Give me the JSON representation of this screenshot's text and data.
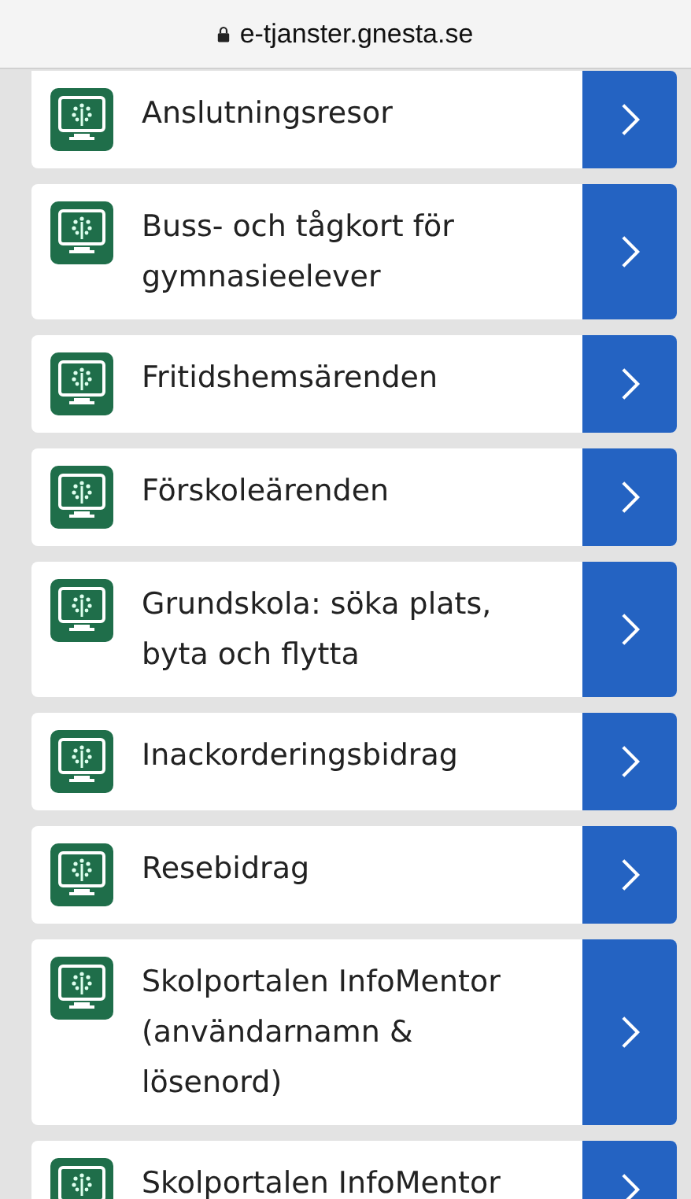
{
  "address_bar": {
    "url": "e-tjanster.gnesta.se"
  },
  "items": [
    {
      "label": "Anslutningsresor"
    },
    {
      "label": "Buss- och tågkort för gymnasieelever"
    },
    {
      "label": "Fritidshemsärenden"
    },
    {
      "label": "Förskoleärenden"
    },
    {
      "label": "Grundskola: söka plats, byta och flytta"
    },
    {
      "label": "Inackorderingsbidrag"
    },
    {
      "label": "Resebidrag"
    },
    {
      "label": "Skolportalen InfoMentor (användarnamn & lösenord)"
    },
    {
      "label": "Skolportalen InfoMentor"
    }
  ]
}
